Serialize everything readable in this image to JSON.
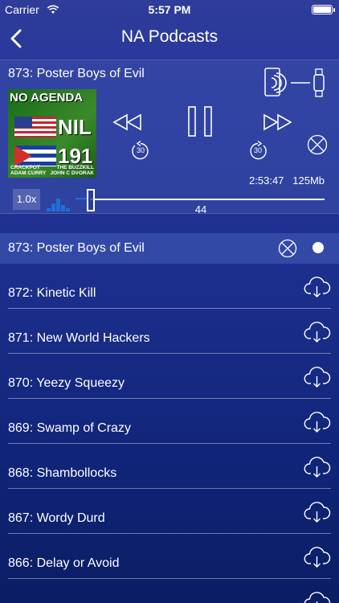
{
  "status_bar": {
    "carrier": "Carrier",
    "time": "5:57 PM"
  },
  "navbar": {
    "title": "NA Podcasts"
  },
  "player": {
    "episode_title": "873: Poster Boys of Evil",
    "cover": {
      "brand": "NO AGENDA",
      "word": "NIL",
      "number": "191",
      "credit_left_role": "CRACKPOT",
      "credit_left_name": "ADAM CURRY",
      "credit_right_role": "THE BUZZKILL",
      "credit_right_name": "JOHN C DVORAK"
    },
    "skip_back_seconds": "30",
    "skip_forward_seconds": "30",
    "duration": "2:53:47",
    "size": "125Mb",
    "speed": "1.0x",
    "position": "44"
  },
  "current_episode": {
    "label": "873: Poster Boys of Evil"
  },
  "episodes": [
    {
      "label": "872: Kinetic Kill"
    },
    {
      "label": "871: New World Hackers"
    },
    {
      "label": "870: Yeezy Squeezy"
    },
    {
      "label": "869: Swamp of Crazy"
    },
    {
      "label": "868: Shambollocks"
    },
    {
      "label": "867: Wordy Durd"
    },
    {
      "label": "866: Delay or Avoid"
    },
    {
      "label": ""
    }
  ]
}
